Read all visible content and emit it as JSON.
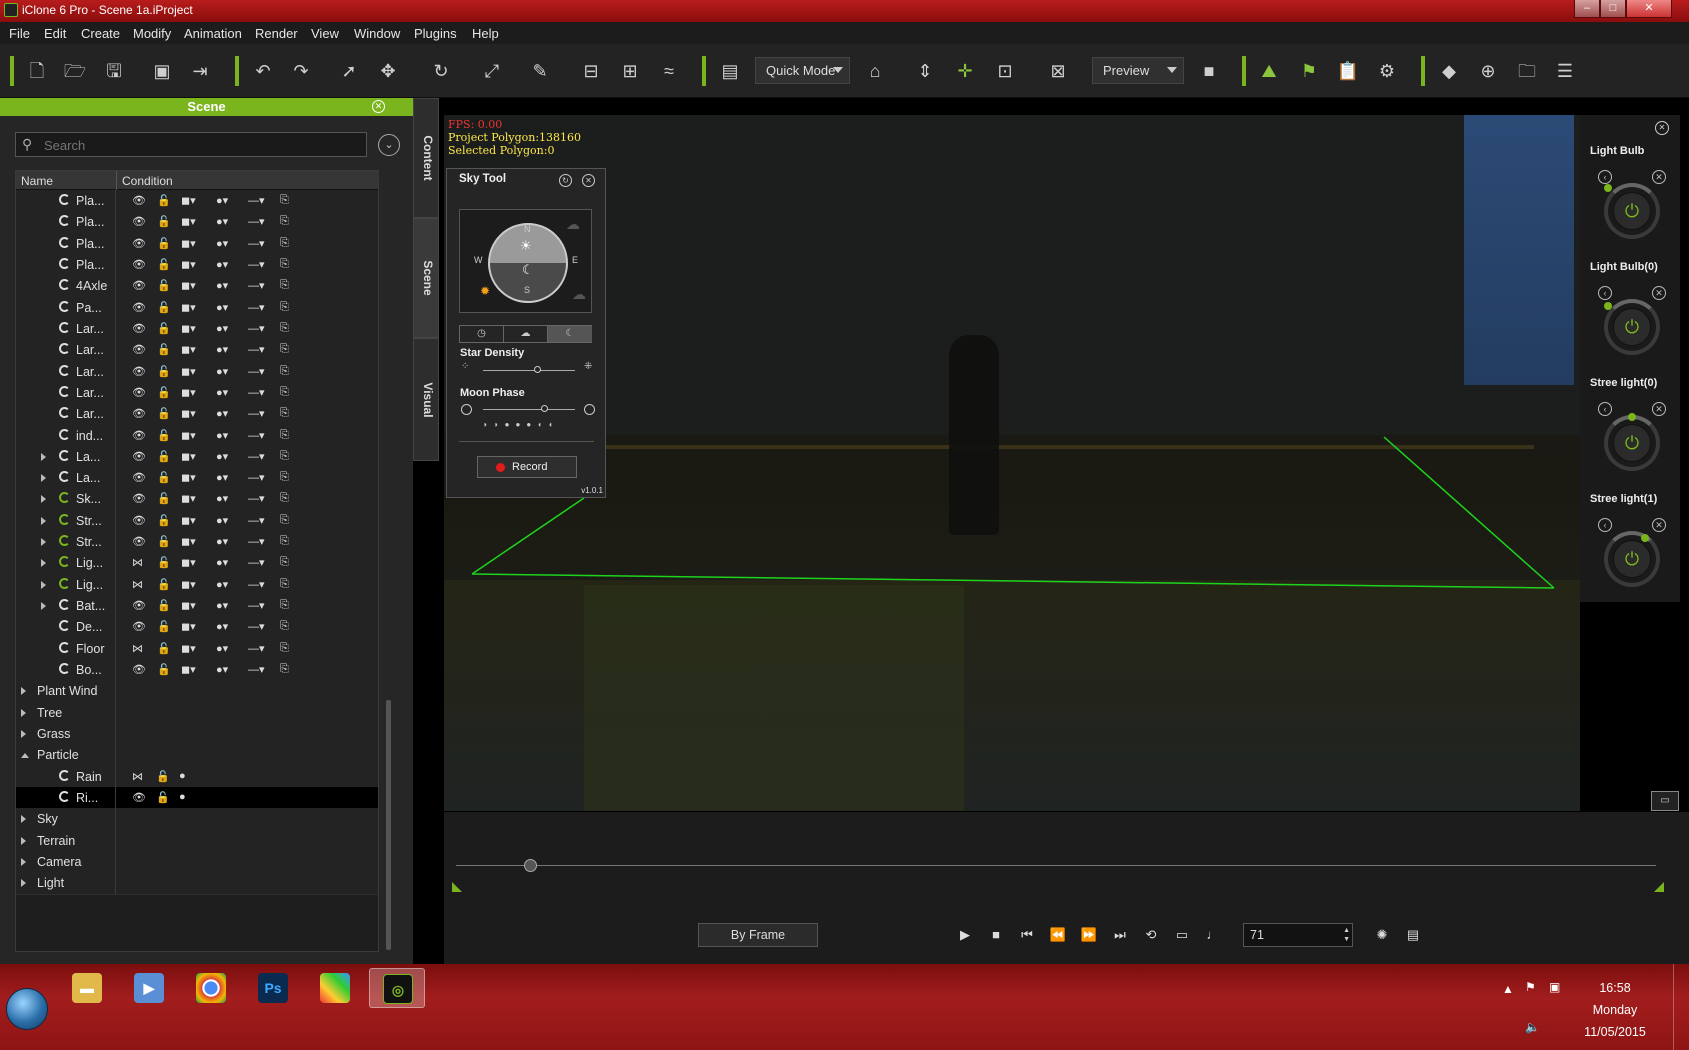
{
  "window": {
    "title": "iClone 6 Pro - Scene 1a.iProject"
  },
  "menu": [
    "File",
    "Edit",
    "Create",
    "Modify",
    "Animation",
    "Render",
    "View",
    "Window",
    "Plugins",
    "Help"
  ],
  "toolbar": {
    "mode": "Quick Mode",
    "render_mode": "Preview"
  },
  "scene_panel": {
    "title": "Scene",
    "search_placeholder": "Search",
    "col_name": "Name",
    "col_condition": "Condition",
    "rows": [
      {
        "label": "Pla...",
        "indent": 2,
        "expand": "",
        "green": false,
        "vis": "eye"
      },
      {
        "label": "Pla...",
        "indent": 2,
        "expand": "",
        "green": false,
        "vis": "eye"
      },
      {
        "label": "Pla...",
        "indent": 2,
        "expand": "",
        "green": false,
        "vis": "eye"
      },
      {
        "label": "Pla...",
        "indent": 2,
        "expand": "",
        "green": false,
        "vis": "eye"
      },
      {
        "label": "4Axle",
        "indent": 2,
        "expand": "",
        "green": false,
        "vis": "eye"
      },
      {
        "label": "Pa...",
        "indent": 2,
        "expand": "",
        "green": false,
        "vis": "eye"
      },
      {
        "label": "Lar...",
        "indent": 2,
        "expand": "",
        "green": false,
        "vis": "eye"
      },
      {
        "label": "Lar...",
        "indent": 2,
        "expand": "",
        "green": false,
        "vis": "eye"
      },
      {
        "label": "Lar...",
        "indent": 2,
        "expand": "",
        "green": false,
        "vis": "eye"
      },
      {
        "label": "Lar...",
        "indent": 2,
        "expand": "",
        "green": false,
        "vis": "eye"
      },
      {
        "label": "Lar...",
        "indent": 2,
        "expand": "",
        "green": false,
        "vis": "eye"
      },
      {
        "label": "ind...",
        "indent": 2,
        "expand": "",
        "green": false,
        "vis": "eye"
      },
      {
        "label": "La...",
        "indent": 2,
        "expand": "closed",
        "green": false,
        "vis": "eye"
      },
      {
        "label": "La...",
        "indent": 2,
        "expand": "closed",
        "green": false,
        "vis": "eye"
      },
      {
        "label": "Sk...",
        "indent": 2,
        "expand": "closed",
        "green": true,
        "vis": "eye"
      },
      {
        "label": "Str...",
        "indent": 2,
        "expand": "closed",
        "green": true,
        "vis": "eye"
      },
      {
        "label": "Str...",
        "indent": 2,
        "expand": "closed",
        "green": true,
        "vis": "eye"
      },
      {
        "label": "Lig...",
        "indent": 2,
        "expand": "closed",
        "green": true,
        "vis": "closed"
      },
      {
        "label": "Lig...",
        "indent": 2,
        "expand": "closed",
        "green": true,
        "vis": "closed"
      },
      {
        "label": "Bat...",
        "indent": 2,
        "expand": "closed",
        "green": false,
        "vis": "eye"
      },
      {
        "label": "De...",
        "indent": 2,
        "expand": "",
        "green": false,
        "vis": "eye"
      },
      {
        "label": "Floor",
        "indent": 2,
        "expand": "",
        "green": false,
        "vis": "closed"
      },
      {
        "label": "Bo...",
        "indent": 2,
        "expand": "",
        "green": false,
        "vis": "eye"
      }
    ],
    "groups": [
      {
        "label": "Plant Wind",
        "open": false
      },
      {
        "label": "Tree",
        "open": false
      },
      {
        "label": "Grass",
        "open": false
      },
      {
        "label": "Particle",
        "open": true
      }
    ],
    "particles": [
      {
        "label": "Rain",
        "selected": false,
        "vis": "closed"
      },
      {
        "label": "Ri...",
        "selected": true,
        "vis": "eye"
      }
    ],
    "groups2": [
      {
        "label": "Sky"
      },
      {
        "label": "Terrain"
      },
      {
        "label": "Camera"
      },
      {
        "label": "Light"
      }
    ]
  },
  "side_tabs": [
    "Content",
    "Scene",
    "Visual"
  ],
  "viewport": {
    "fps": "FPS: 0.00",
    "project_polygon": "Project Polygon:138160",
    "selected_polygon": "Selected Polygon:0"
  },
  "sky_tool": {
    "title": "Sky Tool",
    "compass": [
      "N",
      "E",
      "S",
      "W"
    ],
    "star_density_label": "Star Density",
    "star_density": 0.6,
    "moon_phase_label": "Moon Phase",
    "moon_phase": 0.67,
    "record_label": "Record",
    "version": "v1.0.1"
  },
  "lights": [
    {
      "name": "Light Bulb"
    },
    {
      "name": "Light Bulb(0)"
    },
    {
      "name": "Stree light(0)"
    },
    {
      "name": "Stree light(1)"
    }
  ],
  "timeline": {
    "by_frame_label": "By Frame",
    "current_frame": "71"
  },
  "taskbar": {
    "apps": [
      "explorer",
      "media-player",
      "chrome",
      "photoshop",
      "color-app",
      "iclone"
    ],
    "active_app": "iclone",
    "time": "16:58",
    "day": "Monday",
    "date": "11/05/2015"
  },
  "colors": {
    "accent": "#7ab51d",
    "titlebar": "#a01515"
  }
}
